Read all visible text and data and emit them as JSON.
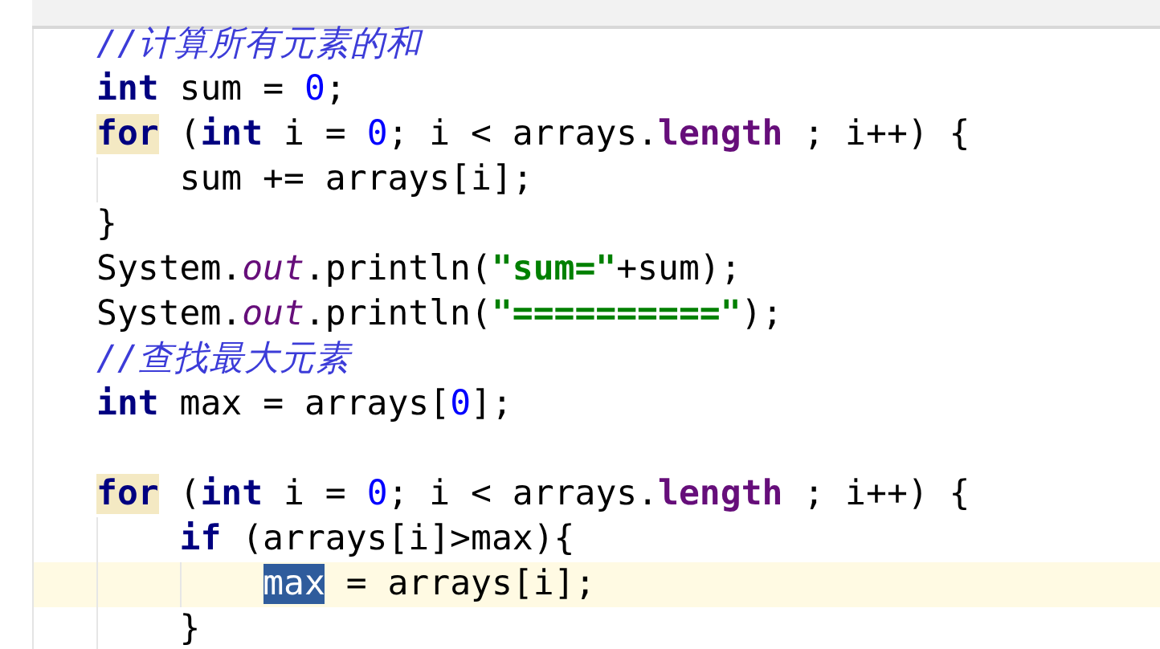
{
  "editor": {
    "lines": [
      {
        "current": false,
        "tokens": [
          {
            "text": "//计算所有元素的和",
            "kind": "comment"
          }
        ]
      },
      {
        "current": false,
        "tokens": [
          {
            "text": "int",
            "kind": "keyword"
          },
          {
            "text": " sum = ",
            "kind": "plain"
          },
          {
            "text": "0",
            "kind": "number"
          },
          {
            "text": ";",
            "kind": "plain"
          }
        ]
      },
      {
        "current": false,
        "tokens": [
          {
            "text": "for",
            "kind": "keyword",
            "highlight": true
          },
          {
            "text": " (",
            "kind": "plain"
          },
          {
            "text": "int",
            "kind": "keyword"
          },
          {
            "text": " i = ",
            "kind": "plain"
          },
          {
            "text": "0",
            "kind": "number"
          },
          {
            "text": "; i < arrays.",
            "kind": "plain"
          },
          {
            "text": "length",
            "kind": "field"
          },
          {
            "text": " ; i++) {",
            "kind": "plain"
          }
        ]
      },
      {
        "current": false,
        "tokens": [
          {
            "text": "    sum += arrays[i];",
            "kind": "plain"
          }
        ]
      },
      {
        "current": false,
        "tokens": [
          {
            "text": "}",
            "kind": "plain"
          }
        ]
      },
      {
        "current": false,
        "tokens": [
          {
            "text": "System.",
            "kind": "plain"
          },
          {
            "text": "out",
            "kind": "static"
          },
          {
            "text": ".println(",
            "kind": "plain"
          },
          {
            "text": "\"sum=\"",
            "kind": "string"
          },
          {
            "text": "+sum);",
            "kind": "plain"
          }
        ]
      },
      {
        "current": false,
        "tokens": [
          {
            "text": "System.",
            "kind": "plain"
          },
          {
            "text": "out",
            "kind": "static"
          },
          {
            "text": ".println(",
            "kind": "plain"
          },
          {
            "text": "\"==========\"",
            "kind": "string"
          },
          {
            "text": ");",
            "kind": "plain"
          }
        ]
      },
      {
        "current": false,
        "tokens": [
          {
            "text": "//查找最大元素",
            "kind": "comment"
          }
        ]
      },
      {
        "current": false,
        "tokens": [
          {
            "text": "int",
            "kind": "keyword"
          },
          {
            "text": " max = arrays[",
            "kind": "plain"
          },
          {
            "text": "0",
            "kind": "number"
          },
          {
            "text": "];",
            "kind": "plain"
          }
        ]
      },
      {
        "current": false
      },
      {
        "current": false,
        "tokens": [
          {
            "text": "for",
            "kind": "keyword",
            "highlight": true
          },
          {
            "text": " (",
            "kind": "plain"
          },
          {
            "text": "int",
            "kind": "keyword"
          },
          {
            "text": " i = ",
            "kind": "plain"
          },
          {
            "text": "0",
            "kind": "number"
          },
          {
            "text": "; i < arrays.",
            "kind": "plain"
          },
          {
            "text": "length",
            "kind": "field"
          },
          {
            "text": " ; i++) {",
            "kind": "plain"
          }
        ]
      },
      {
        "current": false,
        "tokens": [
          {
            "text": "    if",
            "kind": "keyword"
          },
          {
            "text": " (arrays[i]>max){",
            "kind": "plain"
          }
        ]
      },
      {
        "current": true,
        "tokens": [
          {
            "text": "        max",
            "kind": "selected"
          },
          {
            "text": " = arrays[i];",
            "kind": "plain"
          }
        ]
      },
      {
        "current": false,
        "tokens": [
          {
            "text": "    }",
            "kind": "plain"
          }
        ]
      }
    ]
  }
}
